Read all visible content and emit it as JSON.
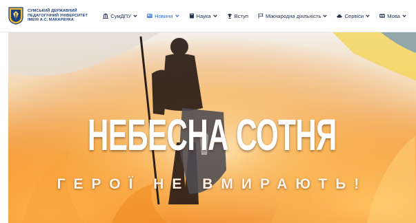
{
  "header": {
    "university_name_line1": "СУМСЬКИЙ ДЕРЖАВНИЙ",
    "university_name_line2": "ПЕДАГОГІЧНИЙ УНІВЕРСИТЕТ",
    "university_name_line3": "ІМЕНІ А.С. МАКАРЕНКА"
  },
  "nav": {
    "items": [
      {
        "label": "СумДПУ",
        "icon": "university-icon",
        "has_dropdown": true
      },
      {
        "label": "Новини",
        "icon": "newspaper-icon",
        "has_dropdown": true,
        "active": true
      },
      {
        "label": "Наука",
        "icon": "book-icon",
        "has_dropdown": true
      },
      {
        "label": "Вступ",
        "icon": "graduate-icon",
        "has_dropdown": false
      },
      {
        "label": "Міжнародна діяльність",
        "icon": "flag-icon",
        "has_dropdown": true
      },
      {
        "label": "Сервіси",
        "icon": "cloud-icon",
        "has_dropdown": true
      },
      {
        "label": "Мова",
        "icon": "language-icon",
        "has_dropdown": true
      }
    ]
  },
  "hero": {
    "headline": "НЕБЕСНА СОТНЯ",
    "subline": "ГЕРОЇ НЕ ВМИРАЮТЬ!"
  },
  "colors": {
    "brand_blue": "#1c3f7a",
    "active_link": "#2f6fe0",
    "fire_orange": "#f08a1e"
  }
}
